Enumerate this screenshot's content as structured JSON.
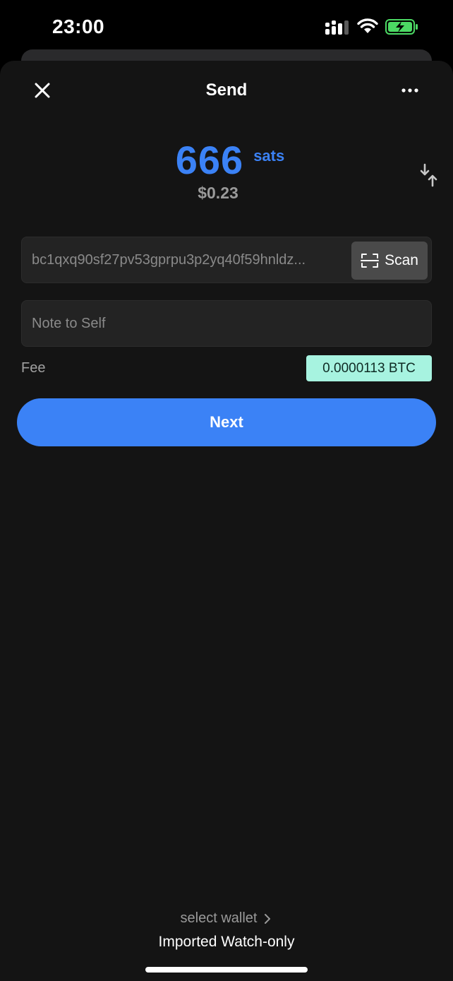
{
  "status_bar": {
    "time": "23:00"
  },
  "header": {
    "title": "Send"
  },
  "amount": {
    "value": "666",
    "unit": "sats",
    "fiat": "$0.23"
  },
  "address": {
    "value": "bc1qxq90sf27pv53gprpu3p2yq40f59hnldz...",
    "scan_label": "Scan"
  },
  "note": {
    "placeholder": "Note to Self"
  },
  "fee": {
    "label": "Fee",
    "value": "0.0000113 BTC"
  },
  "actions": {
    "next_label": "Next"
  },
  "wallet": {
    "select_label": "select wallet",
    "name": "Imported Watch-only"
  },
  "colors": {
    "accent": "#3b82f6",
    "fee_badge": "#a7f3e0",
    "battery": "#4cd964",
    "background": "#141414"
  },
  "icons": [
    "close-icon",
    "more-icon",
    "swap-icon",
    "scan-icon",
    "chevron-right-icon",
    "signal-icon",
    "wifi-icon",
    "battery-charging-icon"
  ]
}
